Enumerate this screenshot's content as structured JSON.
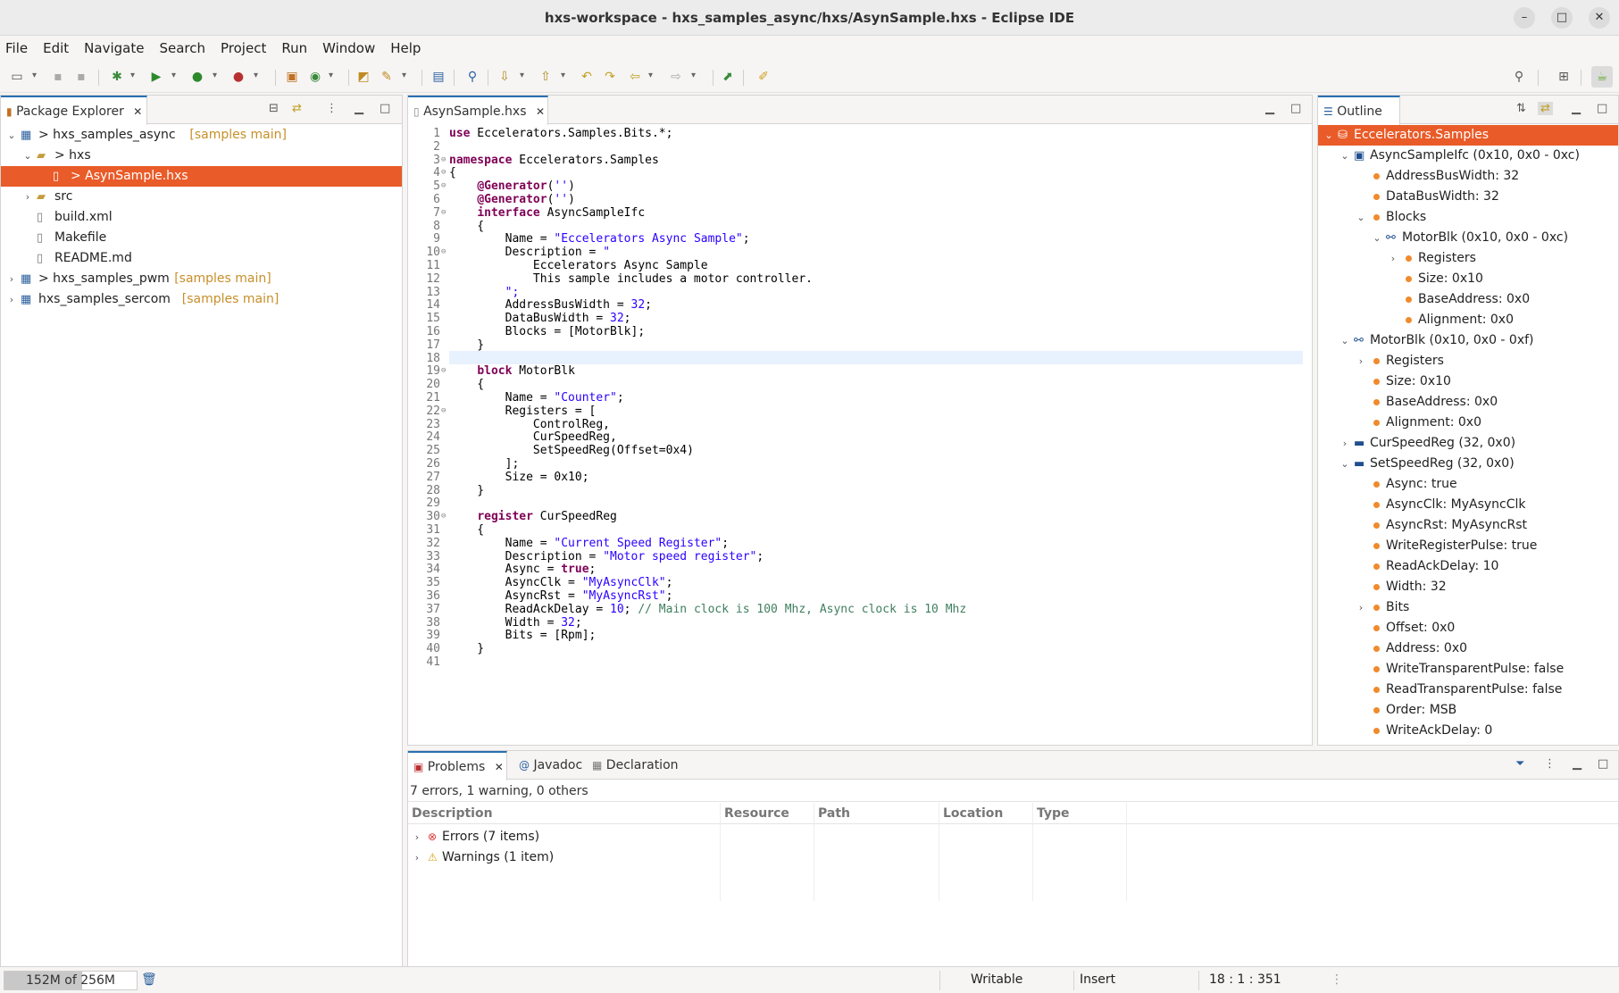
{
  "window": {
    "title": "hxs-workspace - hxs_samples_async/hxs/AsynSample.hxs - Eclipse IDE",
    "minimize": "–",
    "maximize": "□",
    "close": "✕"
  },
  "menu": [
    "File",
    "Edit",
    "Navigate",
    "Search",
    "Project",
    "Run",
    "Window",
    "Help"
  ],
  "package_explorer": {
    "tab_label": "Package Explorer",
    "items": [
      {
        "label": "> hxs_samples_async",
        "deco": "[samples main]",
        "expand": "⌄"
      },
      {
        "label": "> hxs",
        "deco": "",
        "expand": "⌄"
      },
      {
        "label": "> AsynSample.hxs",
        "deco": "",
        "expand": ""
      },
      {
        "label": "src",
        "deco": "",
        "expand": "›"
      },
      {
        "label": "build.xml",
        "deco": "",
        "expand": ""
      },
      {
        "label": "Makefile",
        "deco": "",
        "expand": ""
      },
      {
        "label": "README.md",
        "deco": "",
        "expand": ""
      },
      {
        "label": "> hxs_samples_pwm",
        "deco": "[samples main]",
        "expand": "›"
      },
      {
        "label": "hxs_samples_sercom",
        "deco": "[samples main]",
        "expand": "›"
      }
    ]
  },
  "editor": {
    "tab_label": "AsynSample.hxs",
    "lines": [
      "use Eccelerators.Samples.Bits.*;",
      "",
      "namespace Eccelerators.Samples",
      "{",
      "    @Generator('')",
      "    @Generator('')",
      "    interface AsyncSampleIfc",
      "    {",
      "        Name = \"Eccelerators Async Sample\";",
      "        Description = \"",
      "            Eccelerators Async Sample",
      "            This sample includes a motor controller.",
      "        \";",
      "        AddressBusWidth = 32;",
      "        DataBusWidth = 32;",
      "        Blocks = [MotorBlk];",
      "    }",
      "",
      "    block MotorBlk",
      "    {",
      "        Name = \"Counter\";",
      "        Registers = [",
      "            ControlReg,",
      "            CurSpeedReg,",
      "            SetSpeedReg(Offset=0x4)",
      "        ];",
      "        Size = 0x10;",
      "    }",
      "",
      "    register CurSpeedReg",
      "    {",
      "        Name = \"Current Speed Register\";",
      "        Description = \"Motor speed register\";",
      "        Async = true;",
      "        AsyncClk = \"MyAsyncClk\";",
      "        AsyncRst = \"MyAsyncRst\";",
      "        ReadAckDelay = 10; // Main clock is 100 Mhz, Async clock is 10 Mhz",
      "        Width = 32;",
      "        Bits = [Rpm];",
      "    }",
      ""
    ]
  },
  "outline": {
    "tab_label": "Outline",
    "items": [
      {
        "label": "Eccelerators.Samples",
        "level": 0,
        "expand": "⌄",
        "kind": "db"
      },
      {
        "label": "AsyncSampleIfc (0x10, 0x0 - 0xc)",
        "level": 1,
        "expand": "⌄",
        "kind": "chip"
      },
      {
        "label": "AddressBusWidth: 32",
        "level": 2,
        "expand": "",
        "kind": "bullet"
      },
      {
        "label": "DataBusWidth: 32",
        "level": 2,
        "expand": "",
        "kind": "bullet"
      },
      {
        "label": "Blocks",
        "level": 2,
        "expand": "⌄",
        "kind": "bullet"
      },
      {
        "label": "MotorBlk  (0x10, 0x0 - 0xc)",
        "level": 3,
        "expand": "⌄",
        "kind": "tree"
      },
      {
        "label": "Registers",
        "level": 4,
        "expand": "›",
        "kind": "bullet"
      },
      {
        "label": "Size: 0x10",
        "level": 4,
        "expand": "",
        "kind": "bullet"
      },
      {
        "label": "BaseAddress: 0x0",
        "level": 4,
        "expand": "",
        "kind": "bullet"
      },
      {
        "label": "Alignment: 0x0",
        "level": 4,
        "expand": "",
        "kind": "bullet"
      },
      {
        "label": "MotorBlk  (0x10, 0x0 - 0xf)",
        "level": 1,
        "expand": "⌄",
        "kind": "tree"
      },
      {
        "label": "Registers",
        "level": 2,
        "expand": "›",
        "kind": "bullet"
      },
      {
        "label": "Size: 0x10",
        "level": 2,
        "expand": "",
        "kind": "bullet"
      },
      {
        "label": "BaseAddress: 0x0",
        "level": 2,
        "expand": "",
        "kind": "bullet"
      },
      {
        "label": "Alignment: 0x0",
        "level": 2,
        "expand": "",
        "kind": "bullet"
      },
      {
        "label": "CurSpeedReg (32, 0x0)",
        "level": 1,
        "expand": "›",
        "kind": "reg"
      },
      {
        "label": "SetSpeedReg (32, 0x0)",
        "level": 1,
        "expand": "⌄",
        "kind": "reg"
      },
      {
        "label": "Async: true",
        "level": 2,
        "expand": "",
        "kind": "bullet"
      },
      {
        "label": "AsyncClk: MyAsyncClk",
        "level": 2,
        "expand": "",
        "kind": "bullet"
      },
      {
        "label": "AsyncRst: MyAsyncRst",
        "level": 2,
        "expand": "",
        "kind": "bullet"
      },
      {
        "label": "WriteRegisterPulse: true",
        "level": 2,
        "expand": "",
        "kind": "bullet"
      },
      {
        "label": "ReadAckDelay: 10",
        "level": 2,
        "expand": "",
        "kind": "bullet"
      },
      {
        "label": "Width: 32",
        "level": 2,
        "expand": "",
        "kind": "bullet"
      },
      {
        "label": "Bits",
        "level": 2,
        "expand": "›",
        "kind": "bullet"
      },
      {
        "label": "Offset: 0x0",
        "level": 2,
        "expand": "",
        "kind": "bullet"
      },
      {
        "label": "Address: 0x0",
        "level": 2,
        "expand": "",
        "kind": "bullet"
      },
      {
        "label": "WriteTransparentPulse: false",
        "level": 2,
        "expand": "",
        "kind": "bullet"
      },
      {
        "label": "ReadTransparentPulse: false",
        "level": 2,
        "expand": "",
        "kind": "bullet"
      },
      {
        "label": "Order: MSB",
        "level": 2,
        "expand": "",
        "kind": "bullet"
      },
      {
        "label": "WriteAckDelay: 0",
        "level": 2,
        "expand": "",
        "kind": "bullet"
      }
    ]
  },
  "problems": {
    "tabs": [
      "Problems",
      "Javadoc",
      "Declaration"
    ],
    "summary": "7 errors, 1 warning, 0 others",
    "columns": [
      "Description",
      "Resource",
      "Path",
      "Location",
      "Type"
    ],
    "rows": [
      {
        "label": "Errors (7 items)",
        "icon": "error-icon"
      },
      {
        "label": "Warnings (1 item)",
        "icon": "warning-icon"
      }
    ]
  },
  "status": {
    "heap": "152M of 256M",
    "heap_fraction": 0.59,
    "writable": "Writable",
    "insert": "Insert",
    "position": "18 : 1 : 351"
  },
  "colors": {
    "selection": "#e95b28",
    "keyword": "#7f0055",
    "string": "#2a00ff",
    "comment": "#3f7f5f",
    "decoration": "#c78f2a"
  }
}
